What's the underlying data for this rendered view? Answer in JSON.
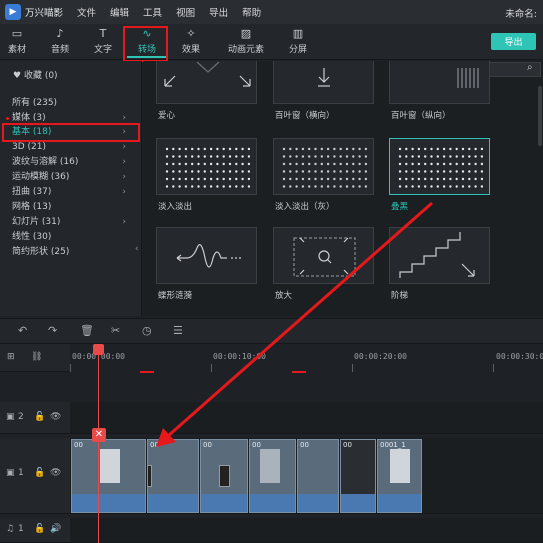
{
  "app": {
    "name": "万兴喵影",
    "doc_title": "未命名:"
  },
  "menu": [
    "文件",
    "编辑",
    "工具",
    "视图",
    "导出",
    "帮助"
  ],
  "toolbar": {
    "tabs": [
      {
        "label": "素材",
        "icon": "folder-icon"
      },
      {
        "label": "音频",
        "icon": "music-note-icon"
      },
      {
        "label": "文字",
        "icon": "text-icon"
      },
      {
        "label": "转场",
        "icon": "transition-icon"
      },
      {
        "label": "效果",
        "icon": "effects-icon"
      },
      {
        "label": "动画元素",
        "icon": "image-icon"
      },
      {
        "label": "分屏",
        "icon": "split-screen-icon"
      }
    ],
    "active_tab": "转场",
    "export_label": "导出"
  },
  "sidebar": {
    "favorites": "收藏 (0)",
    "categories": [
      {
        "label": "所有 (235)",
        "arrow": false
      },
      {
        "label": "媒体 (3)",
        "arrow": true,
        "dot": true
      },
      {
        "label": "基本 (18)",
        "arrow": true,
        "selected": true
      },
      {
        "label": "3D (21)",
        "arrow": true
      },
      {
        "label": "波纹与溶解 (16)",
        "arrow": true
      },
      {
        "label": "运动模糊 (36)",
        "arrow": true
      },
      {
        "label": "扭曲 (37)",
        "arrow": true
      },
      {
        "label": "网格 (13)",
        "arrow": false
      },
      {
        "label": "幻灯片 (31)",
        "arrow": true
      },
      {
        "label": "线性 (30)",
        "arrow": false
      },
      {
        "label": "简约形状 (25)",
        "arrow": false
      }
    ]
  },
  "search": {
    "placeholder": "搜索"
  },
  "transitions": [
    {
      "label": "爱心"
    },
    {
      "label": "百叶窗（横向）"
    },
    {
      "label": "百叶窗（纵向）"
    },
    {
      "label": "淡入淡出"
    },
    {
      "label": "淡入淡出（灰）"
    },
    {
      "label": "叠黑",
      "selected": true
    },
    {
      "label": "蝶形涟漪"
    },
    {
      "label": "放大"
    },
    {
      "label": "阶梯"
    }
  ],
  "timeline": {
    "timecodes": [
      "00:00:00:00",
      "00:00:10:00",
      "00:00:20:00",
      "00:00:30:00"
    ],
    "tracks": [
      {
        "label": "2"
      },
      {
        "label": "1"
      },
      {
        "label": "1"
      }
    ],
    "clip_labels": [
      "00",
      "00",
      "00",
      "00",
      "00",
      "00",
      "0001_1"
    ]
  },
  "colors": {
    "accent": "#2ec4b6",
    "highlight": "#e5191b",
    "playhead": "#e84a4a"
  }
}
